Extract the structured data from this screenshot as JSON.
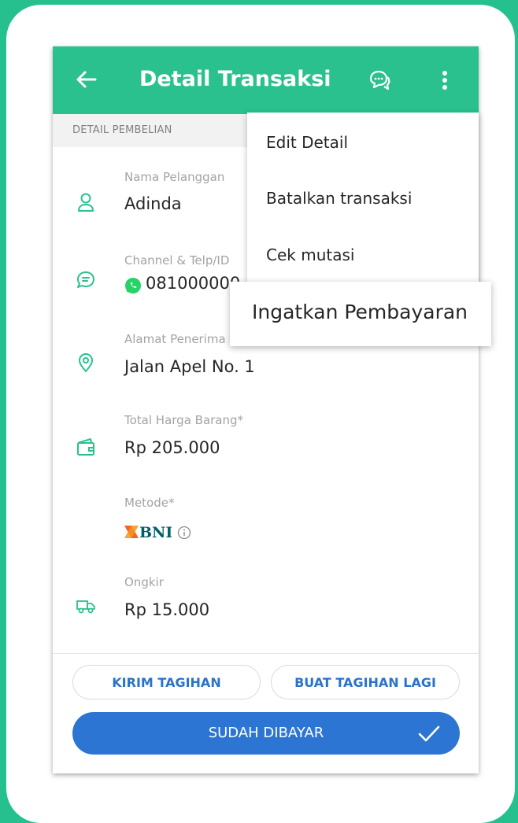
{
  "header": {
    "title": "Detail Transaksi",
    "back_icon": "arrow-left-icon",
    "chat_icon": "chat-bubbles-icon",
    "more_icon": "more-vertical-icon"
  },
  "section_label": "DETAIL PEMBELIAN",
  "fields": {
    "customer": {
      "label": "Nama Pelanggan",
      "value": "Adinda",
      "icon": "person-icon"
    },
    "channel": {
      "label": "Channel & Telp/ID",
      "value": "081000000",
      "icon": "chat-icon"
    },
    "address": {
      "label": "Alamat Penerima",
      "value": "Jalan Apel No. 1",
      "icon": "location-pin-icon"
    },
    "total": {
      "label": "Total Harga Barang*",
      "value": "Rp 205.000",
      "icon": "wallet-icon"
    },
    "method": {
      "label": "Metode*",
      "bank": "BNI",
      "icon": "info-icon"
    },
    "shipping": {
      "label": "Ongkir",
      "value": "Rp 15.000",
      "icon": "truck-icon"
    }
  },
  "actions": {
    "send_invoice": "KIRIM TAGIHAN",
    "create_again": "BUAT TAGIHAN LAGI",
    "mark_paid": "SUDAH DIBAYAR"
  },
  "menu": {
    "items": [
      "Edit Detail",
      "Batalkan transaksi",
      "Cek mutasi"
    ],
    "highlighted": "Ingatkan Pembayaran"
  },
  "colors": {
    "brand_green": "#2ac18f",
    "primary_blue": "#2d75d3",
    "icon_green": "#2ac18f"
  }
}
